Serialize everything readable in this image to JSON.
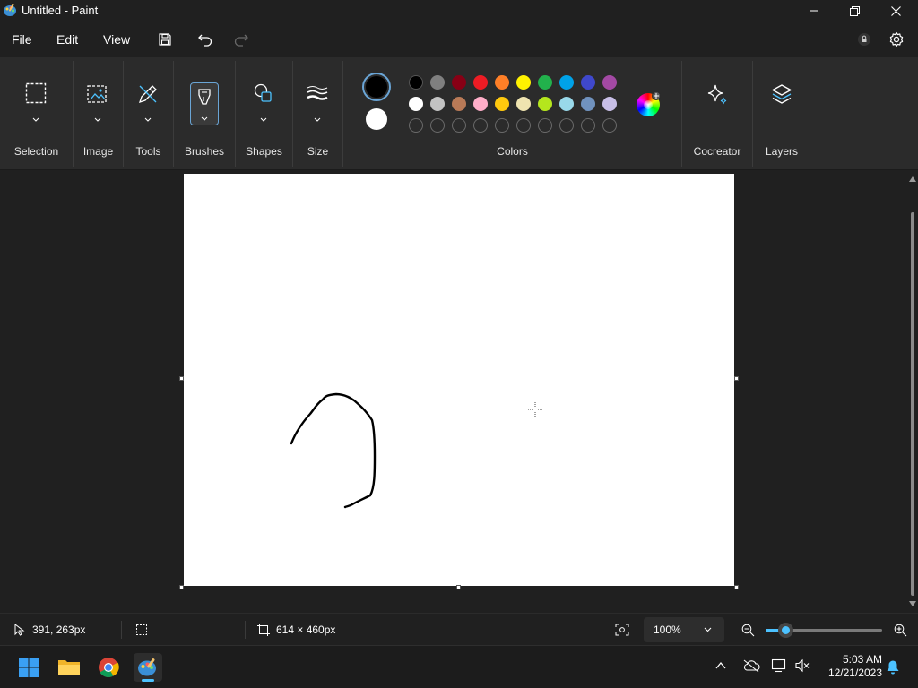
{
  "window": {
    "title": "Untitled - Paint"
  },
  "menu": {
    "file": "File",
    "edit": "Edit",
    "view": "View"
  },
  "ribbon": {
    "groups": {
      "selection": "Selection",
      "image": "Image",
      "tools": "Tools",
      "brushes": "Brushes",
      "shapes": "Shapes",
      "size": "Size",
      "colors": "Colors",
      "cocreator": "Cocreator",
      "layers": "Layers"
    },
    "primary_color": "#000000",
    "secondary_color": "#ffffff",
    "palette_row1": [
      "#000000",
      "#7f7f7f",
      "#880015",
      "#ed1c24",
      "#ff7f27",
      "#fff200",
      "#22b14c",
      "#00a2e8",
      "#3f48cc",
      "#a349a4"
    ],
    "palette_row2": [
      "#ffffff",
      "#c3c3c3",
      "#b97a57",
      "#ffaec9",
      "#ffc90e",
      "#efe4b0",
      "#b5e61d",
      "#99d9ea",
      "#7092be",
      "#c8bfe7"
    ],
    "accent": "#4cc2ff"
  },
  "status": {
    "cursor_position": "391, 263px",
    "canvas_size": "614 × 460px",
    "zoom": "100%"
  },
  "taskbar": {
    "time": "5:03 AM",
    "date": "12/21/2023"
  }
}
